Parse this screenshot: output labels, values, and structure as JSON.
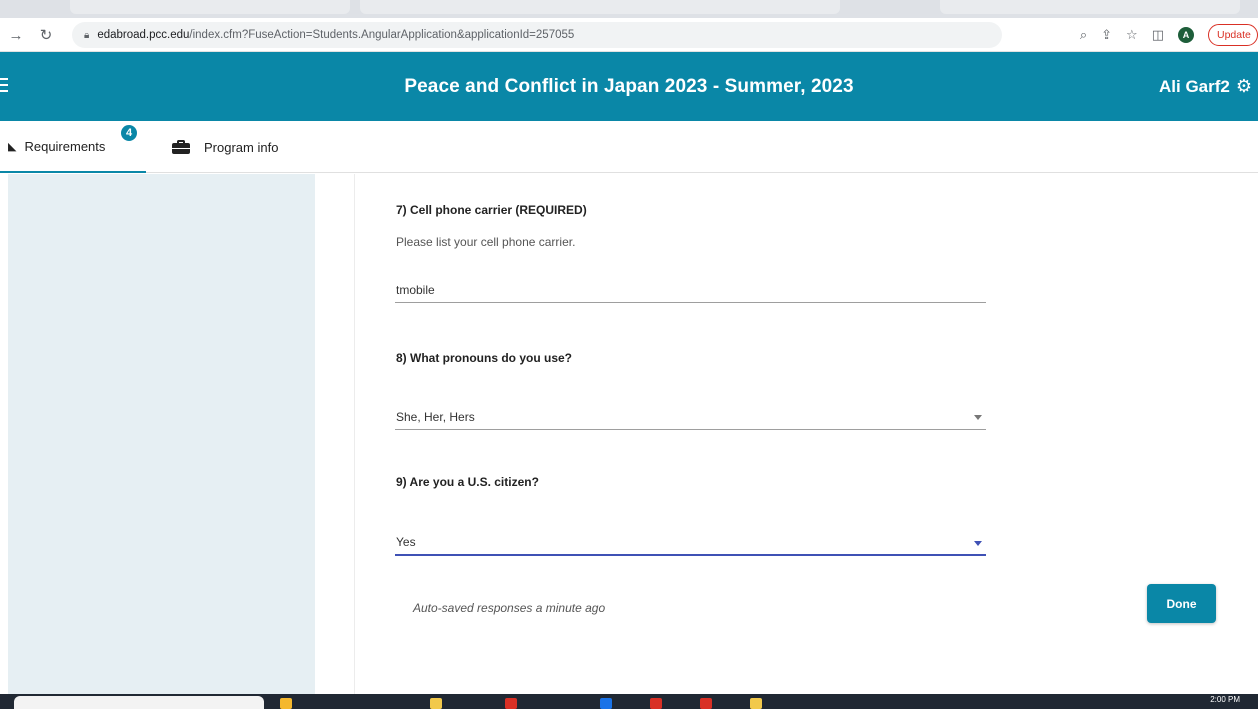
{
  "browser": {
    "url_host": "edabroad.pcc.edu",
    "url_path": "/index.cfm?FuseAction=Students.AngularApplication&applicationId=257055",
    "profile_initial": "A",
    "update_label": "Update"
  },
  "header": {
    "title": "Peace and Conflict in Japan 2023 - Summer, 2023",
    "user_name": "Ali Garf2"
  },
  "tabs": [
    {
      "label": "Requirements",
      "badge": "4",
      "active": true
    },
    {
      "label": "Program info",
      "active": false
    }
  ],
  "questions": [
    {
      "title": "7) Cell phone carrier (REQUIRED)",
      "help": "Please list your cell phone carrier.",
      "value": "tmobile",
      "type": "text"
    },
    {
      "title": "8) What pronouns do you use?",
      "value": "She, Her, Hers",
      "type": "select"
    },
    {
      "title": "9) Are you a U.S. citizen?",
      "value": "Yes",
      "type": "select"
    }
  ],
  "footer": {
    "autosave_text": "Auto-saved responses a minute ago",
    "done_label": "Done"
  },
  "taskbar": {
    "clock": "2:00 PM"
  },
  "colors": {
    "brand": "#0a87a7",
    "sidebar_bg": "#e6eff3",
    "focus": "#3f51b5"
  }
}
